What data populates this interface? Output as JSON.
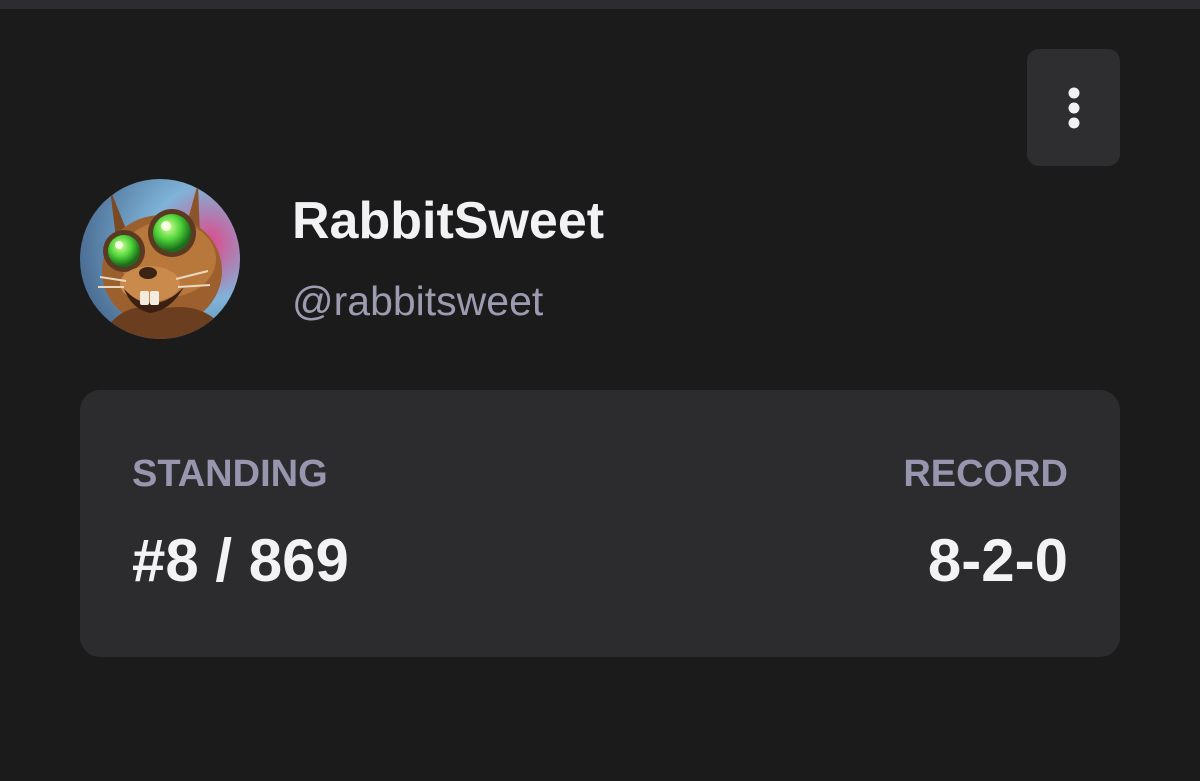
{
  "profile": {
    "display_name": "RabbitSweet",
    "handle": "@rabbitsweet",
    "avatar_icon": "rabbit-robot-avatar"
  },
  "menu": {
    "icon": "vertical-ellipsis-icon"
  },
  "stats": {
    "standing_label": "STANDING",
    "standing_value": "#8 / 869",
    "record_label": "RECORD",
    "record_value": "8-2-0"
  },
  "colors": {
    "background": "#1b1b1c",
    "card": "#2c2c2e",
    "label": "#9796ae",
    "text": "#f3f3f5"
  }
}
